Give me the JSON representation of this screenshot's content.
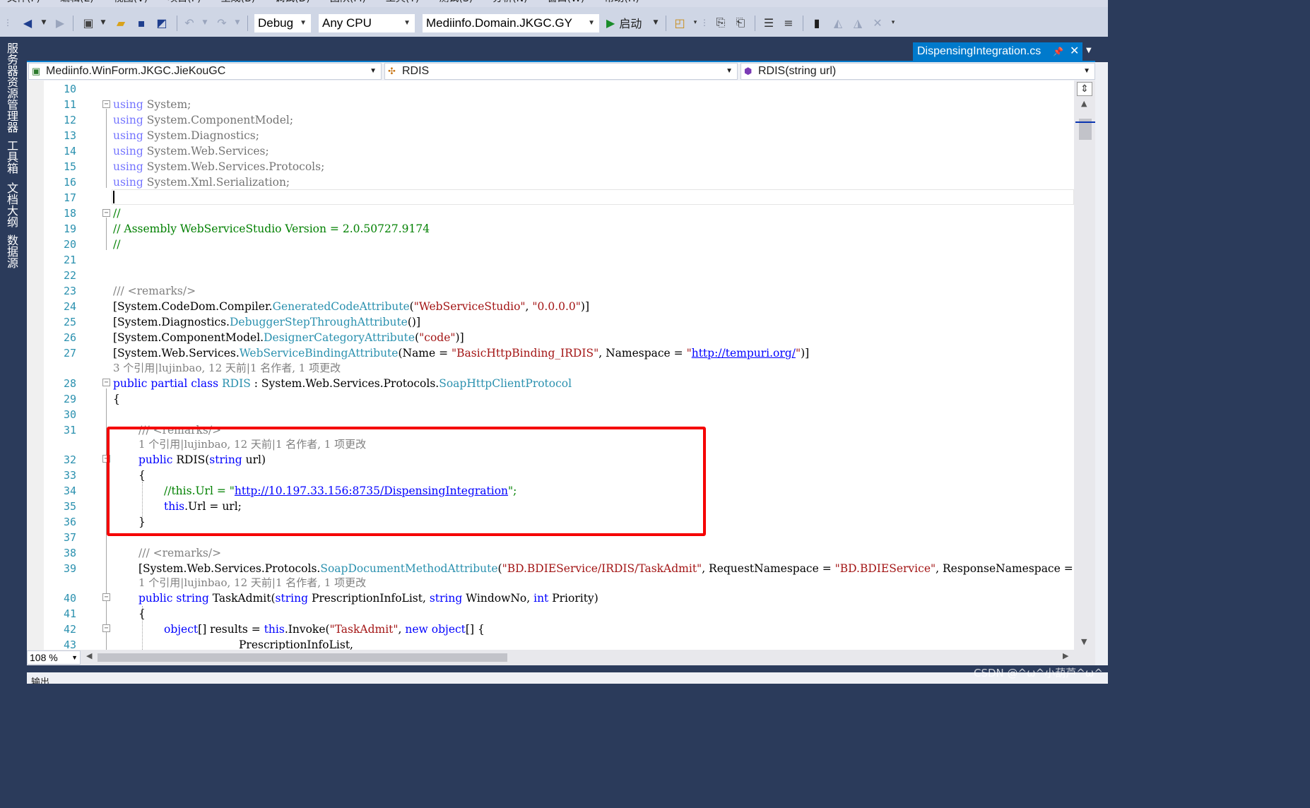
{
  "menu": [
    "文件(F)",
    "编辑(E)",
    "视图(V)",
    "项目(P)",
    "生成(B)",
    "调试(D)",
    "团队(M)",
    "工具(T)",
    "测试(S)",
    "分析(N)",
    "窗口(W)",
    "帮助(H)"
  ],
  "toolbar": {
    "config": "Debug",
    "platform": "Any CPU",
    "project": "Mediinfo.Domain.JKGC.GY",
    "start_label": "启动"
  },
  "left_tabs": [
    "服务器资源管理器",
    "工具箱",
    "文档大纲",
    "数据源"
  ],
  "doc_tab": {
    "title": "DispensingIntegration.cs"
  },
  "nav": {
    "project": "Mediinfo.WinForm.JKGC.JieKouGC",
    "class": "RDIS",
    "member": "RDIS(string url)"
  },
  "code": {
    "ln10": "10",
    "ln11": "11",
    "ln12": "12",
    "ln13": "13",
    "ln14": "14",
    "ln15": "15",
    "ln16": "16",
    "ln17": "17",
    "ln18": "18",
    "ln19": "19",
    "ln20": "20",
    "ln21": "21",
    "ln22": "22",
    "ln23": "23",
    "ln24": "24",
    "ln25": "25",
    "ln26": "26",
    "ln27": "27",
    "ln28": "28",
    "ln29": "29",
    "ln30": "30",
    "ln31": "31",
    "ln32": "32",
    "ln33": "33",
    "ln34": "34",
    "ln35": "35",
    "ln36": "36",
    "ln37": "37",
    "ln38": "38",
    "ln39": "39",
    "ln40": "40",
    "ln41": "41",
    "ln42": "42",
    "ln43": "43",
    "using_kw": "using",
    "ns11": " System;",
    "ns12": " System.ComponentModel;",
    "ns13": " System.Diagnostics;",
    "ns14": " System.Web.Services;",
    "ns15": " System.Web.Services.Protocols;",
    "ns16": " System.Xml.Serialization;",
    "c18": "//",
    "c19": "// Assembly WebServiceStudio Version = 2.0.50727.9174",
    "c20": "//",
    "c23": "/// <remarks/>",
    "a24_pre": "[System.CodeDom.Compiler.",
    "a24_type": "GeneratedCodeAttribute",
    "a24_p1": "(",
    "a24_s1": "\"WebServiceStudio\"",
    "a24_p2": ", ",
    "a24_s2": "\"0.0.0.0\"",
    "a24_p3": ")]",
    "a25_pre": "[System.Diagnostics.",
    "a25_type": "DebuggerStepThroughAttribute",
    "a25_post": "()]",
    "a26_pre": "[System.ComponentModel.",
    "a26_type": "DesignerCategoryAttribute",
    "a26_p1": "(",
    "a26_s1": "\"code\"",
    "a26_p2": ")]",
    "a27_pre": "[System.Web.Services.",
    "a27_type": "WebServiceBindingAttribute",
    "a27_p1": "(Name = ",
    "a27_s1": "\"BasicHttpBinding_IRDIS\"",
    "a27_p2": ", Namespace = ",
    "a27_q1": "\"",
    "a27_url": "http://tempuri.org/",
    "a27_q2": "\"",
    "a27_p3": ")]",
    "lens28": "3 个引用|lujinbao, 12 天前|1 名作者, 1 项更改",
    "k28_public": "public",
    "k28_partial": "partial",
    "k28_class": "class",
    "t28_name": "RDIS",
    "p28_mid": " : System.Web.Services.Protocols.",
    "t28_base": "SoapHttpClientProtocol",
    "b29": "{",
    "c31": "/// <remarks/>",
    "lens32": "1 个引用|lujinbao, 12 天前|1 名作者, 1 项更改",
    "k32_public": "public",
    "p32_name": " RDIS(",
    "k32_string": "string",
    "p32_end": " url)",
    "b33": "{",
    "c34_pre": "//this.Url = \"",
    "c34_url": "http://10.197.33.156:8735/DispensingIntegration",
    "c34_post": "\";",
    "k35_this": "this",
    "p35_rest": ".Url = url;",
    "b36": "}",
    "c38": "/// <remarks/>",
    "a39_pre": "[System.Web.Services.Protocols.",
    "a39_type": "SoapDocumentMethodAttribute",
    "a39_p1": "(",
    "a39_s1": "\"BD.BDIEService/IRDIS/TaskAdmit\"",
    "a39_p2": ", RequestNamespace = ",
    "a39_s2": "\"BD.BDIEService\"",
    "a39_p3": ", ResponseNamespace =",
    "lens40": "1 个引用|lujinbao, 12 天前|1 名作者, 1 项更改",
    "k40_public": "public",
    "k40_string": "string",
    "p40_name": " TaskAdmit(",
    "k40_string2": "string",
    "p40_a1": " PrescriptionInfoList, ",
    "k40_string3": "string",
    "p40_a2": " WindowNo, ",
    "k40_int": "int",
    "p40_a3": " Priority)",
    "b41": "{",
    "k42_object": "object",
    "p42_a": "[] results = ",
    "k42_this": "this",
    "p42_b": ".Invoke(",
    "s42": "\"TaskAdmit\"",
    "p42_c": ", ",
    "k42_new": "new",
    "k42_object2": "object",
    "p42_d": "[] {",
    "p43": "PrescriptionInfoList,"
  },
  "zoom": "108 %",
  "output_label": "输出",
  "watermark": "CSDN @^ω^小葫芦^ω^",
  "colors": {
    "accent": "#007acc",
    "highlight_box": "#f50000",
    "keyword": "#0000ff",
    "type": "#2b91af",
    "string": "#a31515",
    "comment": "#008000"
  }
}
